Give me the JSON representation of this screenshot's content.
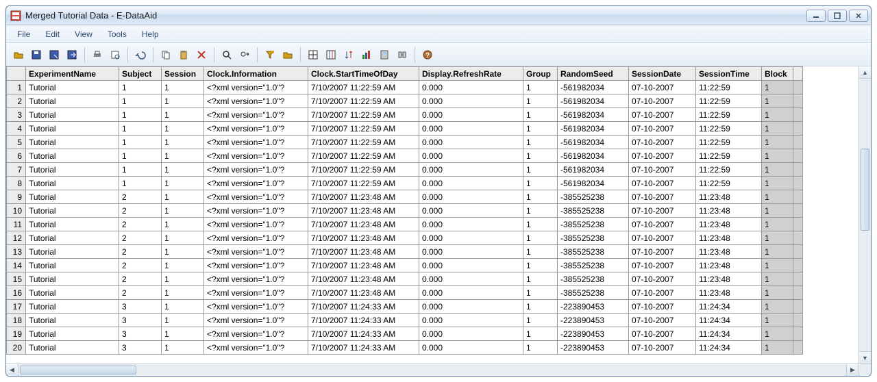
{
  "window": {
    "title": "Merged Tutorial Data - E-DataAid"
  },
  "menu": {
    "items": [
      "File",
      "Edit",
      "View",
      "Tools",
      "Help"
    ]
  },
  "toolbar": {
    "icons": [
      "open-icon",
      "save-icon",
      "save-as-icon",
      "export-icon",
      "sep",
      "print-icon",
      "print-preview-icon",
      "sep",
      "undo-icon",
      "sep",
      "copy-icon",
      "paste-icon",
      "delete-icon",
      "sep",
      "find-icon",
      "find-next-icon",
      "sep",
      "filter-icon",
      "folder-icon",
      "sep",
      "grid-icon",
      "columns-icon",
      "sort-icon",
      "analyze-icon",
      "calculator-icon",
      "merge-icon",
      "sep",
      "help-icon"
    ]
  },
  "columns": [
    "ExperimentName",
    "Subject",
    "Session",
    "Clock.Information",
    "Clock.StartTimeOfDay",
    "Display.RefreshRate",
    "Group",
    "RandomSeed",
    "SessionDate",
    "SessionTime",
    "Block"
  ],
  "rows": [
    {
      "n": 1,
      "ExperimentName": "Tutorial",
      "Subject": "1",
      "Session": "1",
      "Clock.Information": "<?xml version=\"1.0\"?",
      "Clock.StartTimeOfDay": "7/10/2007 11:22:59 AM",
      "Display.RefreshRate": "0.000",
      "Group": "1",
      "RandomSeed": "-561982034",
      "SessionDate": "07-10-2007",
      "SessionTime": "11:22:59",
      "Block": "1"
    },
    {
      "n": 2,
      "ExperimentName": "Tutorial",
      "Subject": "1",
      "Session": "1",
      "Clock.Information": "<?xml version=\"1.0\"?",
      "Clock.StartTimeOfDay": "7/10/2007 11:22:59 AM",
      "Display.RefreshRate": "0.000",
      "Group": "1",
      "RandomSeed": "-561982034",
      "SessionDate": "07-10-2007",
      "SessionTime": "11:22:59",
      "Block": "1"
    },
    {
      "n": 3,
      "ExperimentName": "Tutorial",
      "Subject": "1",
      "Session": "1",
      "Clock.Information": "<?xml version=\"1.0\"?",
      "Clock.StartTimeOfDay": "7/10/2007 11:22:59 AM",
      "Display.RefreshRate": "0.000",
      "Group": "1",
      "RandomSeed": "-561982034",
      "SessionDate": "07-10-2007",
      "SessionTime": "11:22:59",
      "Block": "1"
    },
    {
      "n": 4,
      "ExperimentName": "Tutorial",
      "Subject": "1",
      "Session": "1",
      "Clock.Information": "<?xml version=\"1.0\"?",
      "Clock.StartTimeOfDay": "7/10/2007 11:22:59 AM",
      "Display.RefreshRate": "0.000",
      "Group": "1",
      "RandomSeed": "-561982034",
      "SessionDate": "07-10-2007",
      "SessionTime": "11:22:59",
      "Block": "1"
    },
    {
      "n": 5,
      "ExperimentName": "Tutorial",
      "Subject": "1",
      "Session": "1",
      "Clock.Information": "<?xml version=\"1.0\"?",
      "Clock.StartTimeOfDay": "7/10/2007 11:22:59 AM",
      "Display.RefreshRate": "0.000",
      "Group": "1",
      "RandomSeed": "-561982034",
      "SessionDate": "07-10-2007",
      "SessionTime": "11:22:59",
      "Block": "1"
    },
    {
      "n": 6,
      "ExperimentName": "Tutorial",
      "Subject": "1",
      "Session": "1",
      "Clock.Information": "<?xml version=\"1.0\"?",
      "Clock.StartTimeOfDay": "7/10/2007 11:22:59 AM",
      "Display.RefreshRate": "0.000",
      "Group": "1",
      "RandomSeed": "-561982034",
      "SessionDate": "07-10-2007",
      "SessionTime": "11:22:59",
      "Block": "1"
    },
    {
      "n": 7,
      "ExperimentName": "Tutorial",
      "Subject": "1",
      "Session": "1",
      "Clock.Information": "<?xml version=\"1.0\"?",
      "Clock.StartTimeOfDay": "7/10/2007 11:22:59 AM",
      "Display.RefreshRate": "0.000",
      "Group": "1",
      "RandomSeed": "-561982034",
      "SessionDate": "07-10-2007",
      "SessionTime": "11:22:59",
      "Block": "1"
    },
    {
      "n": 8,
      "ExperimentName": "Tutorial",
      "Subject": "1",
      "Session": "1",
      "Clock.Information": "<?xml version=\"1.0\"?",
      "Clock.StartTimeOfDay": "7/10/2007 11:22:59 AM",
      "Display.RefreshRate": "0.000",
      "Group": "1",
      "RandomSeed": "-561982034",
      "SessionDate": "07-10-2007",
      "SessionTime": "11:22:59",
      "Block": "1"
    },
    {
      "n": 9,
      "ExperimentName": "Tutorial",
      "Subject": "2",
      "Session": "1",
      "Clock.Information": "<?xml version=\"1.0\"?",
      "Clock.StartTimeOfDay": "7/10/2007 11:23:48 AM",
      "Display.RefreshRate": "0.000",
      "Group": "1",
      "RandomSeed": "-385525238",
      "SessionDate": "07-10-2007",
      "SessionTime": "11:23:48",
      "Block": "1"
    },
    {
      "n": 10,
      "ExperimentName": "Tutorial",
      "Subject": "2",
      "Session": "1",
      "Clock.Information": "<?xml version=\"1.0\"?",
      "Clock.StartTimeOfDay": "7/10/2007 11:23:48 AM",
      "Display.RefreshRate": "0.000",
      "Group": "1",
      "RandomSeed": "-385525238",
      "SessionDate": "07-10-2007",
      "SessionTime": "11:23:48",
      "Block": "1"
    },
    {
      "n": 11,
      "ExperimentName": "Tutorial",
      "Subject": "2",
      "Session": "1",
      "Clock.Information": "<?xml version=\"1.0\"?",
      "Clock.StartTimeOfDay": "7/10/2007 11:23:48 AM",
      "Display.RefreshRate": "0.000",
      "Group": "1",
      "RandomSeed": "-385525238",
      "SessionDate": "07-10-2007",
      "SessionTime": "11:23:48",
      "Block": "1"
    },
    {
      "n": 12,
      "ExperimentName": "Tutorial",
      "Subject": "2",
      "Session": "1",
      "Clock.Information": "<?xml version=\"1.0\"?",
      "Clock.StartTimeOfDay": "7/10/2007 11:23:48 AM",
      "Display.RefreshRate": "0.000",
      "Group": "1",
      "RandomSeed": "-385525238",
      "SessionDate": "07-10-2007",
      "SessionTime": "11:23:48",
      "Block": "1"
    },
    {
      "n": 13,
      "ExperimentName": "Tutorial",
      "Subject": "2",
      "Session": "1",
      "Clock.Information": "<?xml version=\"1.0\"?",
      "Clock.StartTimeOfDay": "7/10/2007 11:23:48 AM",
      "Display.RefreshRate": "0.000",
      "Group": "1",
      "RandomSeed": "-385525238",
      "SessionDate": "07-10-2007",
      "SessionTime": "11:23:48",
      "Block": "1"
    },
    {
      "n": 14,
      "ExperimentName": "Tutorial",
      "Subject": "2",
      "Session": "1",
      "Clock.Information": "<?xml version=\"1.0\"?",
      "Clock.StartTimeOfDay": "7/10/2007 11:23:48 AM",
      "Display.RefreshRate": "0.000",
      "Group": "1",
      "RandomSeed": "-385525238",
      "SessionDate": "07-10-2007",
      "SessionTime": "11:23:48",
      "Block": "1"
    },
    {
      "n": 15,
      "ExperimentName": "Tutorial",
      "Subject": "2",
      "Session": "1",
      "Clock.Information": "<?xml version=\"1.0\"?",
      "Clock.StartTimeOfDay": "7/10/2007 11:23:48 AM",
      "Display.RefreshRate": "0.000",
      "Group": "1",
      "RandomSeed": "-385525238",
      "SessionDate": "07-10-2007",
      "SessionTime": "11:23:48",
      "Block": "1"
    },
    {
      "n": 16,
      "ExperimentName": "Tutorial",
      "Subject": "2",
      "Session": "1",
      "Clock.Information": "<?xml version=\"1.0\"?",
      "Clock.StartTimeOfDay": "7/10/2007 11:23:48 AM",
      "Display.RefreshRate": "0.000",
      "Group": "1",
      "RandomSeed": "-385525238",
      "SessionDate": "07-10-2007",
      "SessionTime": "11:23:48",
      "Block": "1"
    },
    {
      "n": 17,
      "ExperimentName": "Tutorial",
      "Subject": "3",
      "Session": "1",
      "Clock.Information": "<?xml version=\"1.0\"?",
      "Clock.StartTimeOfDay": "7/10/2007 11:24:33 AM",
      "Display.RefreshRate": "0.000",
      "Group": "1",
      "RandomSeed": "-223890453",
      "SessionDate": "07-10-2007",
      "SessionTime": "11:24:34",
      "Block": "1"
    },
    {
      "n": 18,
      "ExperimentName": "Tutorial",
      "Subject": "3",
      "Session": "1",
      "Clock.Information": "<?xml version=\"1.0\"?",
      "Clock.StartTimeOfDay": "7/10/2007 11:24:33 AM",
      "Display.RefreshRate": "0.000",
      "Group": "1",
      "RandomSeed": "-223890453",
      "SessionDate": "07-10-2007",
      "SessionTime": "11:24:34",
      "Block": "1"
    },
    {
      "n": 19,
      "ExperimentName": "Tutorial",
      "Subject": "3",
      "Session": "1",
      "Clock.Information": "<?xml version=\"1.0\"?",
      "Clock.StartTimeOfDay": "7/10/2007 11:24:33 AM",
      "Display.RefreshRate": "0.000",
      "Group": "1",
      "RandomSeed": "-223890453",
      "SessionDate": "07-10-2007",
      "SessionTime": "11:24:34",
      "Block": "1"
    },
    {
      "n": 20,
      "ExperimentName": "Tutorial",
      "Subject": "3",
      "Session": "1",
      "Clock.Information": "<?xml version=\"1.0\"?",
      "Clock.StartTimeOfDay": "7/10/2007 11:24:33 AM",
      "Display.RefreshRate": "0.000",
      "Group": "1",
      "RandomSeed": "-223890453",
      "SessionDate": "07-10-2007",
      "SessionTime": "11:24:34",
      "Block": "1"
    }
  ]
}
